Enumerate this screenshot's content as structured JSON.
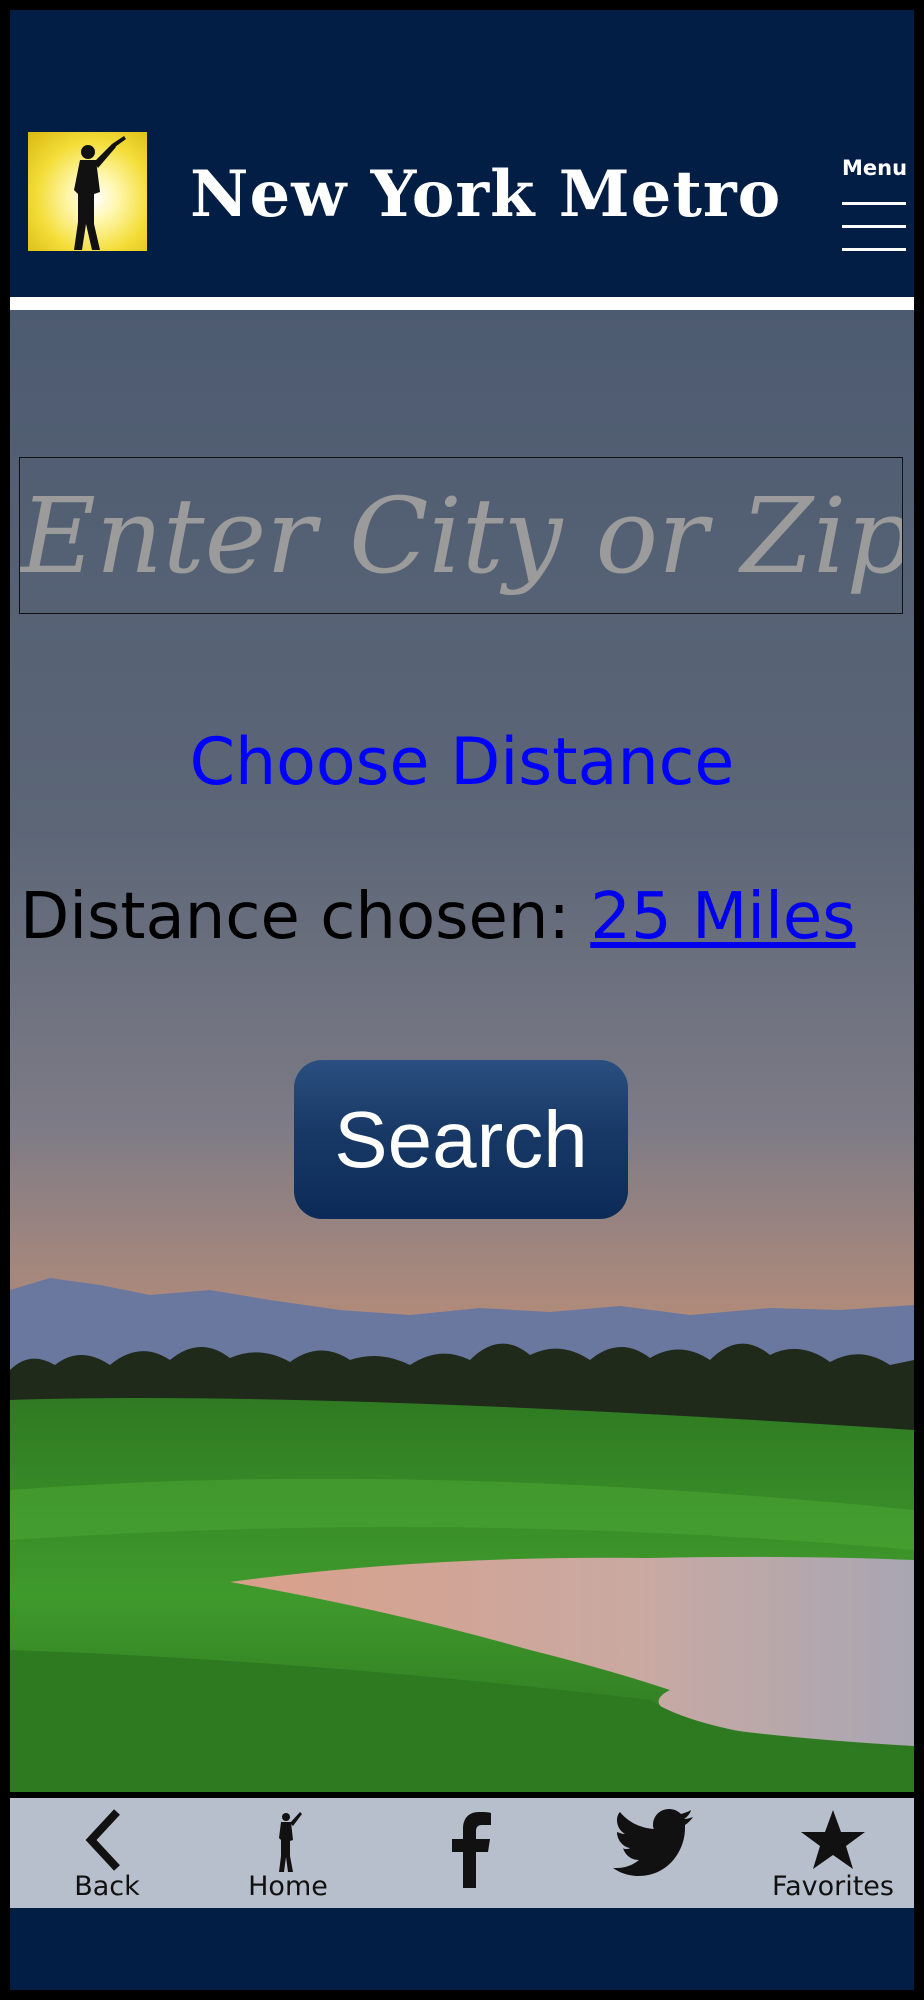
{
  "header": {
    "title": "New York Metro",
    "menu_label": "Menu",
    "logo_icon": "golfer-logo-icon"
  },
  "search": {
    "placeholder": "Enter City or Zip",
    "value": ""
  },
  "distance": {
    "choose_label": "Choose Distance",
    "chosen_prefix": "Distance chosen:",
    "chosen_value": "25 Miles"
  },
  "search_button": {
    "label": "Search"
  },
  "bottom_nav": {
    "items": [
      {
        "label": "Back",
        "icon": "chevron-left-icon"
      },
      {
        "label": "Home",
        "icon": "golfer-icon"
      },
      {
        "label": "",
        "icon": "facebook-icon"
      },
      {
        "label": "",
        "icon": "twitter-icon"
      },
      {
        "label": "Favorites",
        "icon": "star-icon"
      }
    ]
  },
  "colors": {
    "header_bg": "#031e45",
    "link": "#0000ee",
    "choose_distance": "#0000ff",
    "nav_bg": "#b8bfcc"
  }
}
